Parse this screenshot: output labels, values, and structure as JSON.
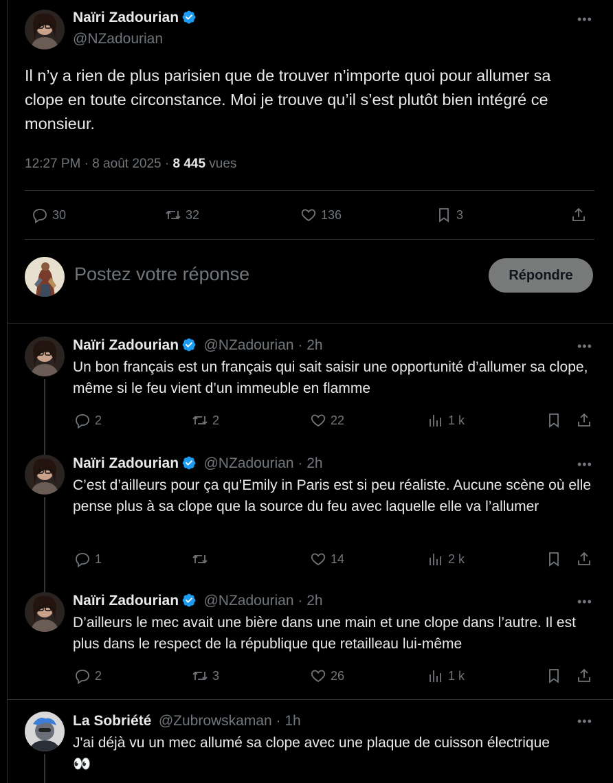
{
  "main_tweet": {
    "author_name": "Naïri Zadourian",
    "author_handle": "@NZadourian",
    "text": "Il n’y a rien de plus parisien que de trouver n’importe quoi pour allumer sa clope en toute circonstance. Moi je trouve qu’il s’est plutôt bien intégré ce monsieur.",
    "time": "12:27 PM · 8 août 2025 · ",
    "views_count": "8 445",
    "views_label": " vues",
    "replies": "30",
    "retweets": "32",
    "likes": "136",
    "bookmarks": "3"
  },
  "composer": {
    "placeholder": "Postez votre réponse",
    "button_label": "Répondre"
  },
  "replies": [
    {
      "author_name": "Naïri Zadourian",
      "author_handle": "@NZadourian · 2h",
      "text": "Un bon français est un français qui sait saisir une opportunité d’allumer sa clope, même si le feu vient d’un immeuble en flamme",
      "replies": "2",
      "retweets": "2",
      "likes": "22",
      "views": "1 k"
    },
    {
      "author_name": "Naïri Zadourian",
      "author_handle": "@NZadourian · 2h",
      "text": "C’est d’ailleurs pour ça qu’Emily in Paris est si peu réaliste. Aucune scène où elle pense plus à sa clope que la source du feu avec laquelle elle va l’allumer",
      "replies": "1",
      "retweets": "",
      "likes": "14",
      "views": "2 k"
    },
    {
      "author_name": "Naïri Zadourian",
      "author_handle": "@NZadourian · 2h",
      "text": "D’ailleurs le mec avait une bière dans une main et une clope dans l’autre. Il est plus dans le respect de la république que retailleau lui-même",
      "replies": "2",
      "retweets": "3",
      "likes": "26",
      "views": "1 k"
    },
    {
      "author_name": "La Sobriété",
      "author_handle": "@Zubrowskaman · 1h",
      "text": "J'ai déjà vu un mec allumé sa clope avec une plaque de cuisson électrique",
      "emoji": "👀"
    }
  ],
  "colors": {
    "background": "#000000",
    "text": "#e7e9ea",
    "muted": "#71767b",
    "verified": "#1d9bf0",
    "divider": "#2f3336",
    "reply_button": "#787a7a"
  },
  "icons": [
    "more-icon",
    "verified-icon",
    "reply-icon",
    "retweet-icon",
    "like-icon",
    "views-icon",
    "bookmark-icon",
    "share-icon"
  ]
}
